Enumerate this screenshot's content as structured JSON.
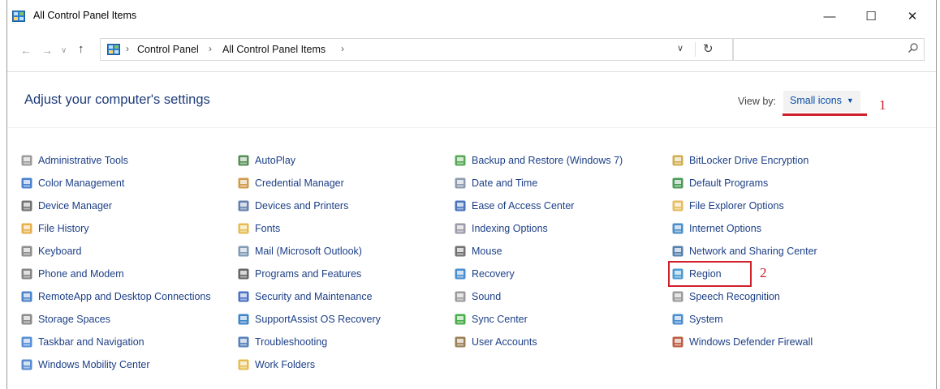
{
  "window": {
    "title": "All Control Panel Items",
    "controls": {
      "minimize": "—",
      "maximize": "☐",
      "close": "✕"
    }
  },
  "address": {
    "crumbs": [
      "Control Panel",
      "All Control Panel Items"
    ],
    "separator": "›",
    "search_placeholder": ""
  },
  "header": {
    "title": "Adjust your computer's settings",
    "view_by_label": "View by:",
    "view_by_value": "Small icons"
  },
  "annotations": {
    "one": "1",
    "two": "2"
  },
  "columns": [
    [
      {
        "label": "Administrative Tools",
        "icon": "admin-tools-icon",
        "color": "#8a8a8a"
      },
      {
        "label": "Color Management",
        "icon": "color-management-icon",
        "color": "#2a6cc8"
      },
      {
        "label": "Device Manager",
        "icon": "device-manager-icon",
        "color": "#5a5a5a"
      },
      {
        "label": "File History",
        "icon": "file-history-icon",
        "color": "#e2a12a"
      },
      {
        "label": "Keyboard",
        "icon": "keyboard-icon",
        "color": "#7a7a7a"
      },
      {
        "label": "Phone and Modem",
        "icon": "phone-modem-icon",
        "color": "#6e6e6e"
      },
      {
        "label": "RemoteApp and Desktop Connections",
        "icon": "remoteapp-icon",
        "color": "#2b6fbf"
      },
      {
        "label": "Storage Spaces",
        "icon": "storage-spaces-icon",
        "color": "#777777"
      },
      {
        "label": "Taskbar and Navigation",
        "icon": "taskbar-icon",
        "color": "#3b7bd0"
      },
      {
        "label": "Windows Mobility Center",
        "icon": "mobility-center-icon",
        "color": "#3a78c8"
      }
    ],
    [
      {
        "label": "AutoPlay",
        "icon": "autoplay-icon",
        "color": "#3a7a3a"
      },
      {
        "label": "Credential Manager",
        "icon": "credential-manager-icon",
        "color": "#c8892a"
      },
      {
        "label": "Devices and Printers",
        "icon": "devices-printers-icon",
        "color": "#4a6aa0"
      },
      {
        "label": "Fonts",
        "icon": "fonts-icon",
        "color": "#e0b030"
      },
      {
        "label": "Mail (Microsoft Outlook)",
        "icon": "mail-icon",
        "color": "#6a8aa8"
      },
      {
        "label": "Programs and Features",
        "icon": "programs-features-icon",
        "color": "#4a4a4a"
      },
      {
        "label": "Security and Maintenance",
        "icon": "security-flag-icon",
        "color": "#2a58b8"
      },
      {
        "label": "SupportAssist OS Recovery",
        "icon": "supportassist-icon",
        "color": "#1f6fc0"
      },
      {
        "label": "Troubleshooting",
        "icon": "troubleshooting-icon",
        "color": "#3a6ab0"
      },
      {
        "label": "Work Folders",
        "icon": "work-folders-icon",
        "color": "#e2b030"
      }
    ],
    [
      {
        "label": "Backup and Restore (Windows 7)",
        "icon": "backup-restore-icon",
        "color": "#3a9a3a"
      },
      {
        "label": "Date and Time",
        "icon": "date-time-icon",
        "color": "#7a8aa0"
      },
      {
        "label": "Ease of Access Center",
        "icon": "ease-of-access-icon",
        "color": "#2a5ab0"
      },
      {
        "label": "Indexing Options",
        "icon": "indexing-icon",
        "color": "#8a8a9a"
      },
      {
        "label": "Mouse",
        "icon": "mouse-icon",
        "color": "#5a5a5a"
      },
      {
        "label": "Recovery",
        "icon": "recovery-icon",
        "color": "#2a7ac8"
      },
      {
        "label": "Sound",
        "icon": "sound-icon",
        "color": "#8a8a8a"
      },
      {
        "label": "Sync Center",
        "icon": "sync-center-icon",
        "color": "#2aa02a"
      },
      {
        "label": "User Accounts",
        "icon": "user-accounts-icon",
        "color": "#8a6a3a"
      }
    ],
    [
      {
        "label": "BitLocker Drive Encryption",
        "icon": "bitlocker-icon",
        "color": "#c8a030"
      },
      {
        "label": "Default Programs",
        "icon": "default-programs-icon",
        "color": "#2a8a3a"
      },
      {
        "label": "File Explorer Options",
        "icon": "file-explorer-options-icon",
        "color": "#e2b040"
      },
      {
        "label": "Internet Options",
        "icon": "internet-options-icon",
        "color": "#2a7ac0"
      },
      {
        "label": "Network and Sharing Center",
        "icon": "network-sharing-icon",
        "color": "#3a6aa0"
      },
      {
        "label": "Region",
        "icon": "region-globe-icon",
        "color": "#2a8ac8"
      },
      {
        "label": "Speech Recognition",
        "icon": "speech-recognition-icon",
        "color": "#8a8a8a"
      },
      {
        "label": "System",
        "icon": "system-icon",
        "color": "#2a7ac8"
      },
      {
        "label": "Windows Defender Firewall",
        "icon": "firewall-icon",
        "color": "#b04020"
      }
    ]
  ]
}
